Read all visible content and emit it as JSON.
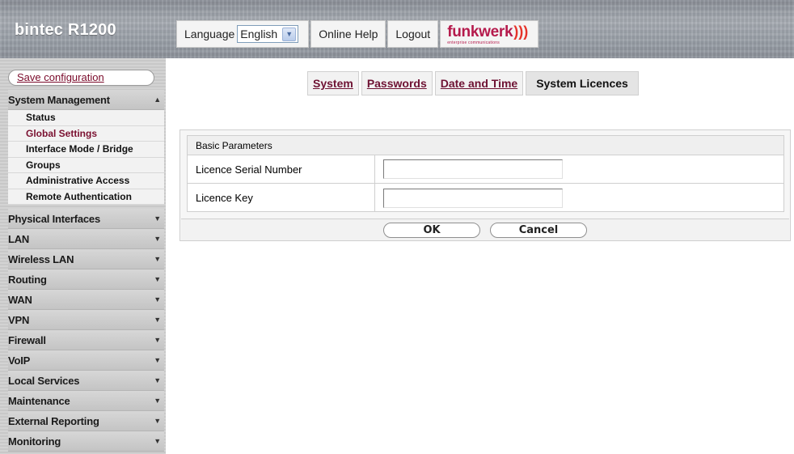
{
  "header": {
    "brand": "bintec R1200",
    "language_label": "Language",
    "language_value": "English",
    "online_help": "Online Help",
    "logout": "Logout",
    "logo_text": "funkwerk",
    "logo_subtext": "enterprise communications",
    "logo_wave": ")))"
  },
  "sidebar": {
    "save_configuration": "Save configuration",
    "system_management": "System Management",
    "sub_items": [
      "Status",
      "Global Settings",
      "Interface Mode / Bridge",
      "Groups",
      "Administrative Access",
      "Remote Authentication"
    ],
    "sections": [
      "Physical Interfaces",
      "LAN",
      "Wireless LAN",
      "Routing",
      "WAN",
      "VPN",
      "Firewall",
      "VoIP",
      "Local Services",
      "Maintenance",
      "External Reporting",
      "Monitoring"
    ]
  },
  "tabs": [
    "System",
    "Passwords",
    "Date and Time",
    "System Licences"
  ],
  "form": {
    "group_title": "Basic Parameters",
    "fields": [
      {
        "label": "Licence Serial Number",
        "value": ""
      },
      {
        "label": "Licence Key",
        "value": ""
      }
    ],
    "ok_label": "OK",
    "cancel_label": "Cancel"
  },
  "colors": {
    "accent": "#7a0a2a",
    "logo": "#b51a4c",
    "sidebar_bg": "#cccccc"
  }
}
